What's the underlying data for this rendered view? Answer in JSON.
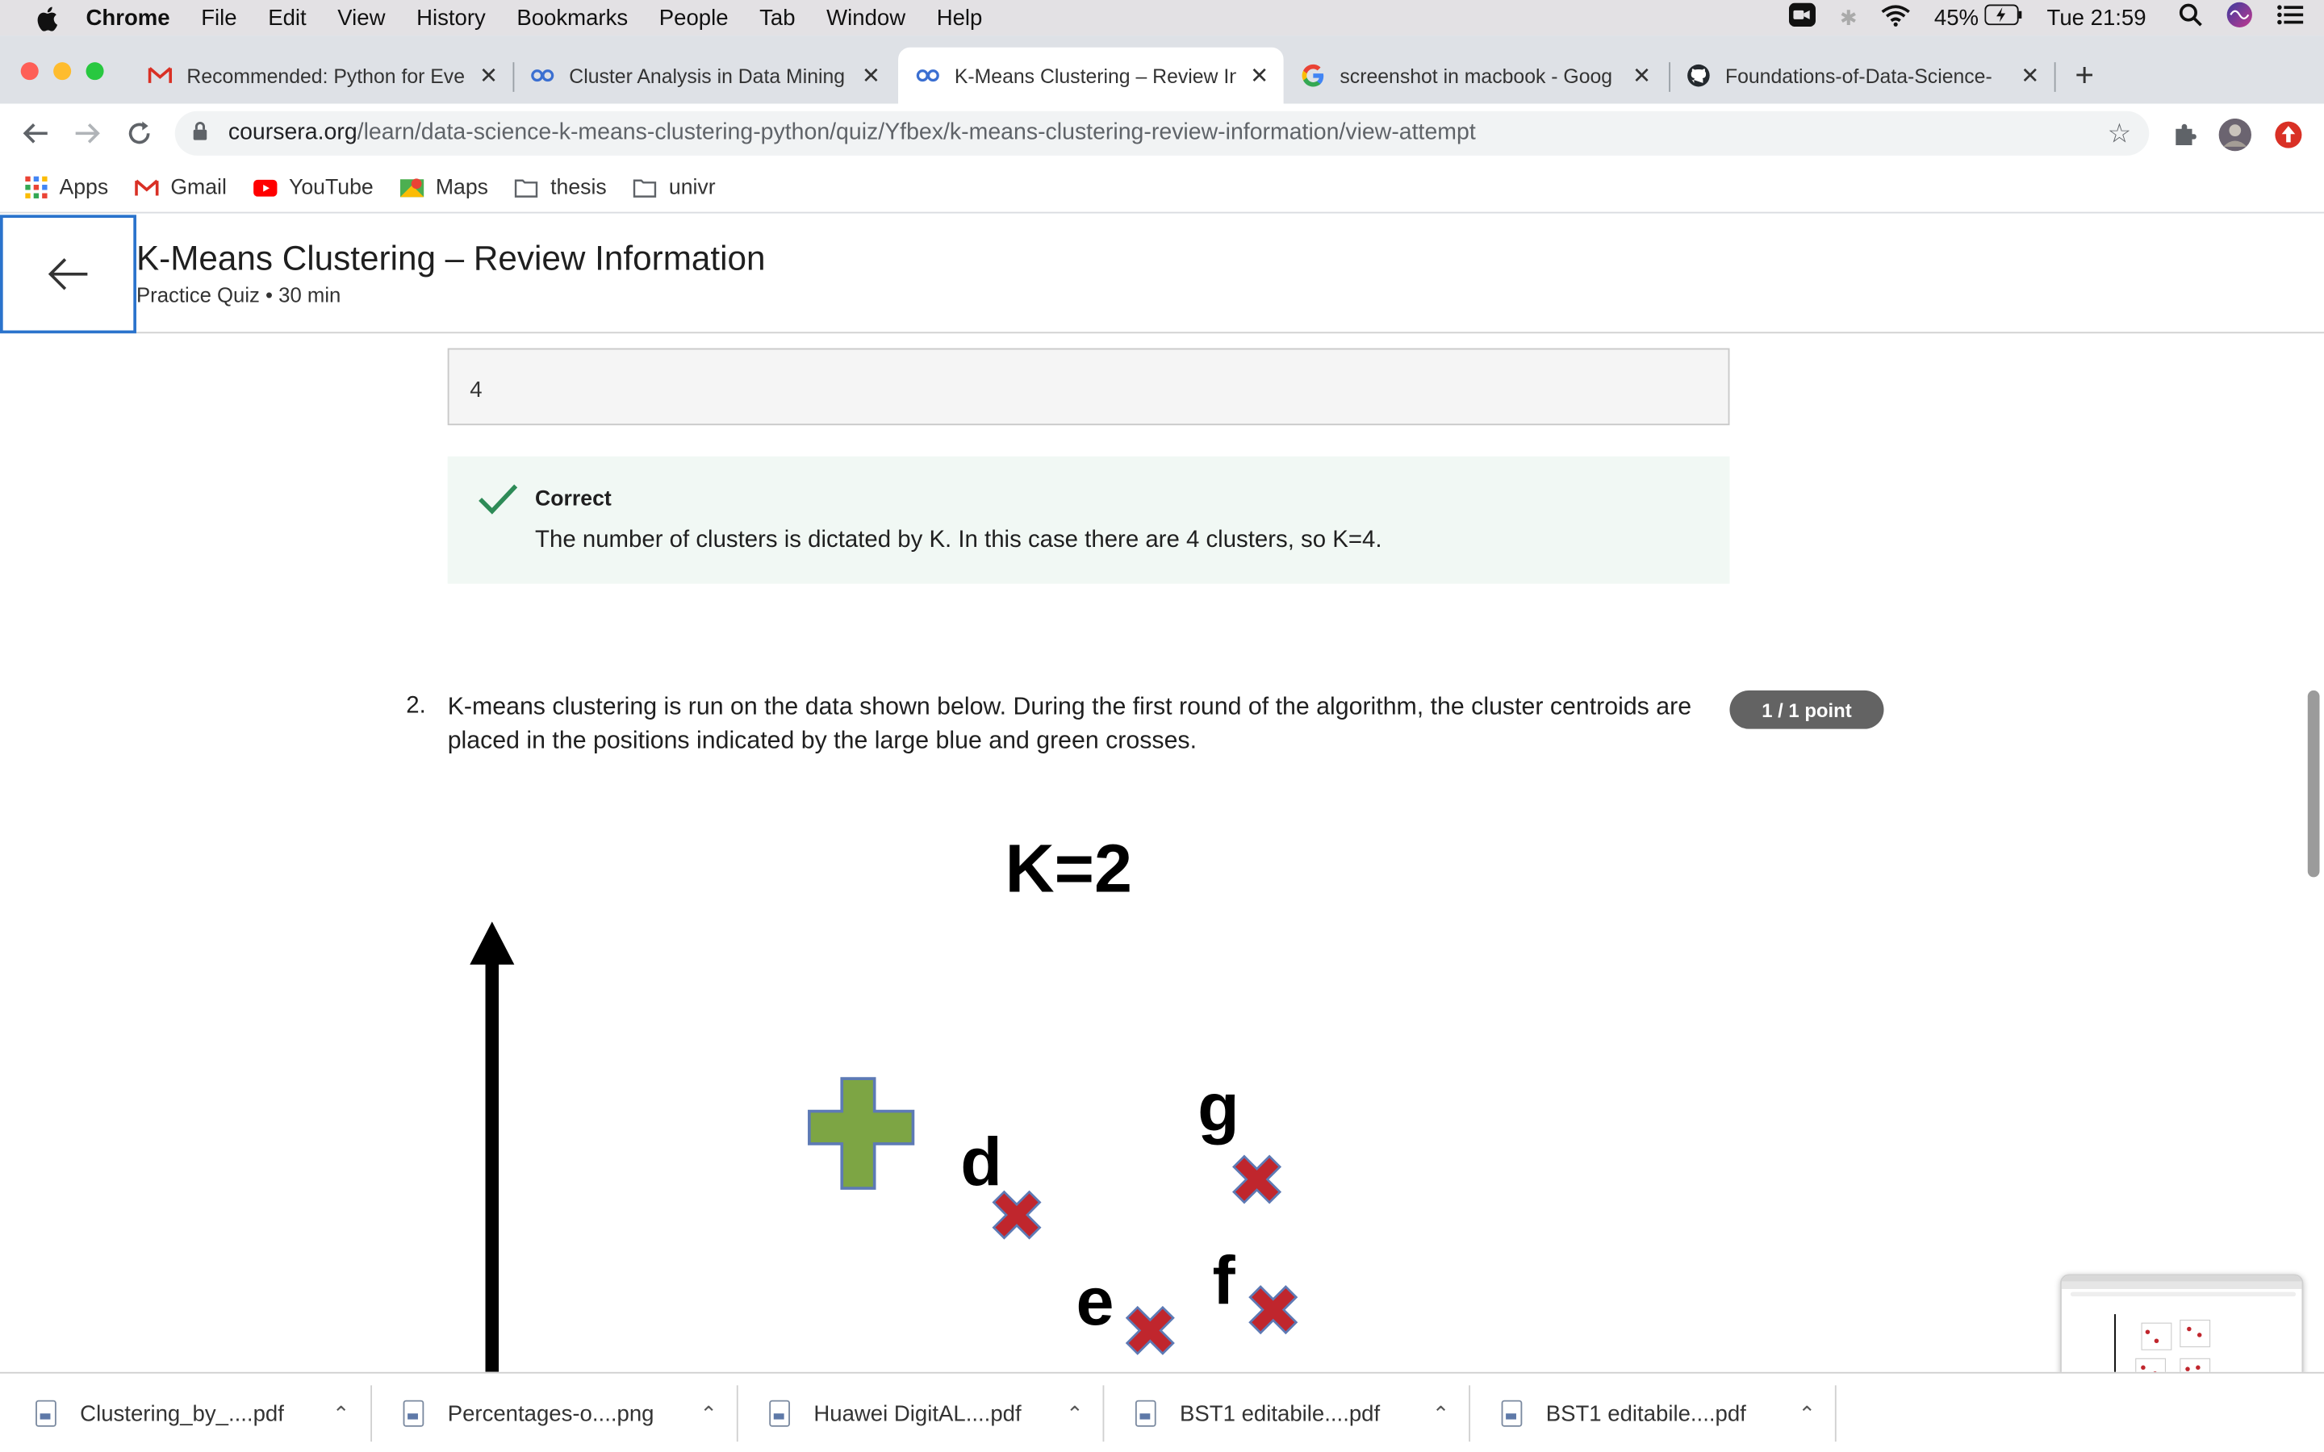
{
  "menubar": {
    "app": "Chrome",
    "items": [
      "File",
      "Edit",
      "View",
      "History",
      "Bookmarks",
      "People",
      "Tab",
      "Window",
      "Help"
    ],
    "battery": "45%",
    "clock": "Tue 21:59"
  },
  "tabs": [
    {
      "title": "Recommended: Python for Eve",
      "icon": "gmail-icon"
    },
    {
      "title": "Cluster Analysis in Data Mining",
      "icon": "coursera-icon"
    },
    {
      "title": "K-Means Clustering – Review In",
      "icon": "coursera-icon",
      "active": true
    },
    {
      "title": "screenshot in macbook - Goog",
      "icon": "google-icon"
    },
    {
      "title": "Foundations-of-Data-Science-",
      "icon": "github-icon"
    }
  ],
  "omnibox": {
    "host": "coursera.org",
    "path": "/learn/data-science-k-means-clustering-python/quiz/Yfbex/k-means-clustering-review-information/view-attempt"
  },
  "bookmarks": [
    "Apps",
    "Gmail",
    "YouTube",
    "Maps",
    "thesis",
    "univr"
  ],
  "header": {
    "title": "K-Means Clustering – Review Information",
    "subtitle": "Practice Quiz • 30 min"
  },
  "q1": {
    "answer": "4",
    "feedback_title": "Correct",
    "feedback_body": "The number of clusters is dictated by K. In this case there are 4 clusters, so K=4."
  },
  "q2": {
    "number": "2.",
    "text": "K-means clustering is run on the data shown below. During the first round of the algorithm, the cluster centroids are placed in the positions indicated by the large blue and green crosses.",
    "points": "1 / 1 point"
  },
  "figure": {
    "title": "K=2",
    "labels": {
      "d": "d",
      "e": "e",
      "f": "f",
      "g": "g"
    }
  },
  "downloads": [
    "Clustering_by_....pdf",
    "Percentages-o....png",
    "Huawei DigitAL....pdf",
    "BST1 editabile....pdf",
    "BST1 editabile....pdf"
  ],
  "colors": {
    "accent": "#2a73cc",
    "correct_bg": "#f1f8f4",
    "check": "#2e8b57",
    "centroid_green": "#7da544",
    "point_red": "#c0262d"
  }
}
